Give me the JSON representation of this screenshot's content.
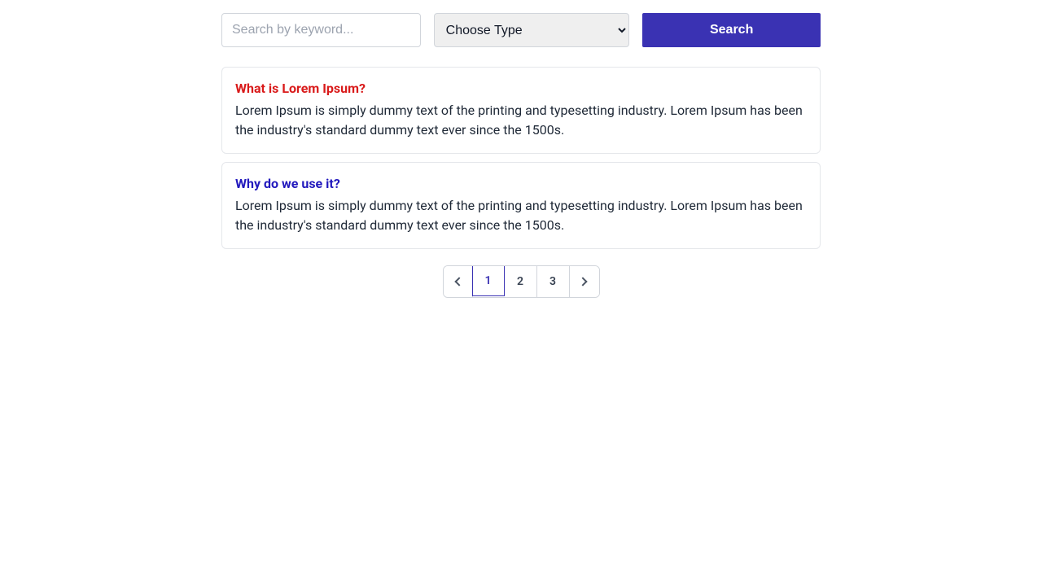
{
  "search": {
    "placeholder": "Search by keyword...",
    "value": "",
    "type_selected": "Choose Type",
    "button_label": "Search"
  },
  "results": [
    {
      "title": "What is Lorem Ipsum?",
      "title_color": "red",
      "body": "Lorem Ipsum is simply dummy text of the printing and typesetting industry. Lorem Ipsum has been the industry's standard dummy text ever since the 1500s."
    },
    {
      "title": "Why do we use it?",
      "title_color": "blue",
      "body": "Lorem Ipsum is simply dummy text of the printing and typesetting industry. Lorem Ipsum has been the industry's standard dummy text ever since the 1500s."
    }
  ],
  "pagination": {
    "pages": [
      "1",
      "2",
      "3"
    ],
    "active_index": 0
  }
}
